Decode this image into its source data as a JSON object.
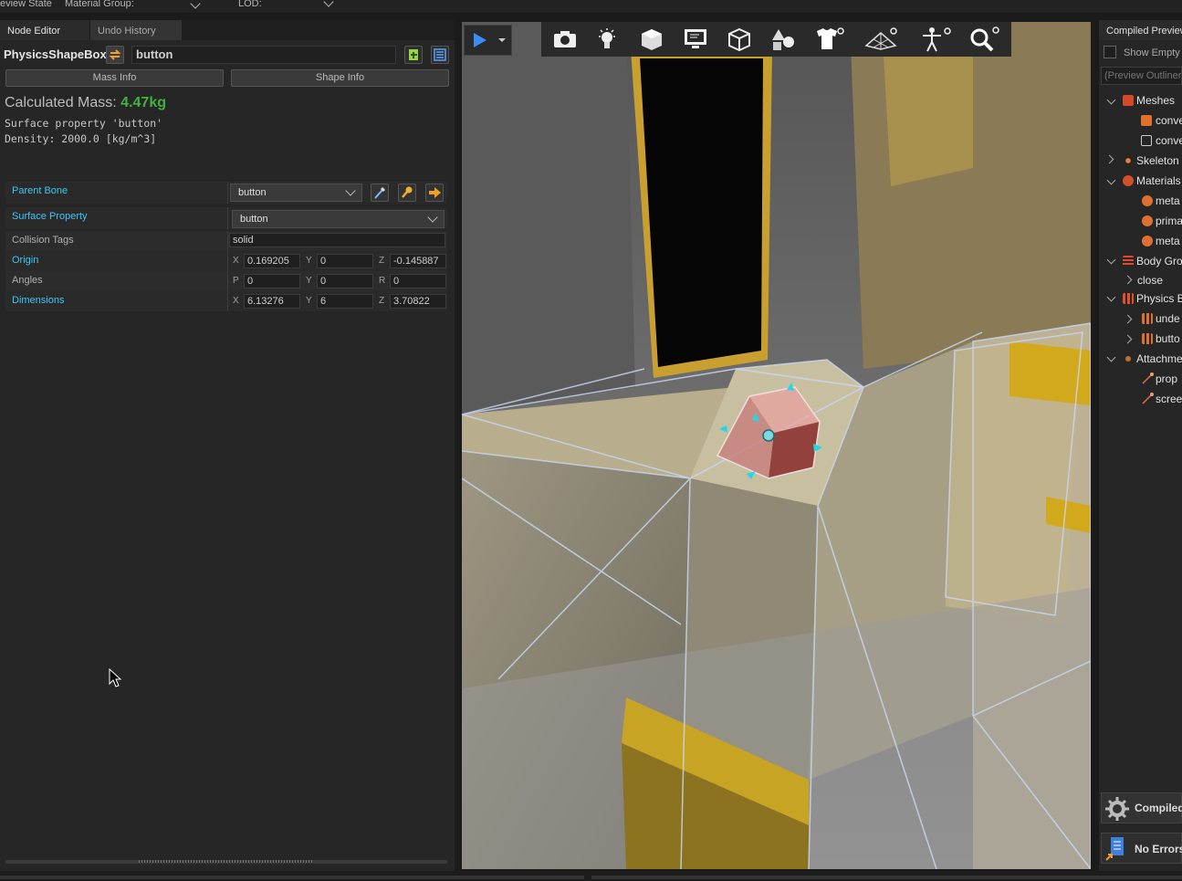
{
  "topbar": {
    "preview_state": "eview State",
    "material_group": "Material Group:",
    "lod": "LOD:"
  },
  "tabs": [
    {
      "label": "Node Editor"
    },
    {
      "label": "Undo History"
    }
  ],
  "node": {
    "type": "PhysicsShapeBox",
    "name": "button",
    "mass_info_label": "Mass Info",
    "shape_info_label": "Shape Info",
    "calc_mass_label": "Calculated Mass:",
    "calc_mass_value": "4.47kg",
    "surface_line": "Surface property 'button'",
    "density_line": "Density: 2000.0 [kg/m^3]"
  },
  "properties": {
    "parent_bone": {
      "label": "Parent Bone",
      "value": "button"
    },
    "surface_property": {
      "label": "Surface Property",
      "value": "button"
    },
    "collision_tags": {
      "label": "Collision Tags",
      "value": "solid"
    },
    "origin": {
      "label": "Origin",
      "ax1": "X",
      "v1": "0.169205",
      "ax2": "Y",
      "v2": "0",
      "ax3": "Z",
      "v3": "-0.145887"
    },
    "angles": {
      "label": "Angles",
      "ax1": "P",
      "v1": "0",
      "ax2": "Y",
      "v2": "0",
      "ax3": "R",
      "v3": "0"
    },
    "dimensions": {
      "label": "Dimensions",
      "ax1": "X",
      "v1": "6.13276",
      "ax2": "Y",
      "v2": "6",
      "ax3": "Z",
      "v3": "3.70822"
    }
  },
  "right_panel": {
    "title": "Compiled Preview",
    "show_empty": "Show Empty",
    "filter_placeholder": "(Preview Outliner",
    "items": [
      {
        "label": "Meshes"
      },
      {
        "label": "conve"
      },
      {
        "label": "conve"
      },
      {
        "label": "Skeleton"
      },
      {
        "label": "Materials"
      },
      {
        "label": "meta"
      },
      {
        "label": "prima"
      },
      {
        "label": "meta"
      },
      {
        "label": "Body Gro"
      },
      {
        "label": "close"
      },
      {
        "label": "Physics B"
      },
      {
        "label": "unde"
      },
      {
        "label": "butto"
      },
      {
        "label": "Attachme"
      },
      {
        "label": "prop"
      },
      {
        "label": "scree"
      }
    ],
    "compiled_label": "Compiled",
    "errors_label": "No Errors"
  },
  "colors": {
    "accent_blue": "#3fc6f2",
    "mass_green": "#3fb43f",
    "panel_bg": "#262626"
  },
  "toolbar_icons": [
    "play-icon",
    "camera-icon",
    "light-bulb-icon",
    "cube-icon",
    "monitor-icon",
    "wireframe-cube-icon",
    "shapes-icon",
    "shirt-icon",
    "grid-icon",
    "skeleton-icon",
    "magnifier-icon"
  ]
}
